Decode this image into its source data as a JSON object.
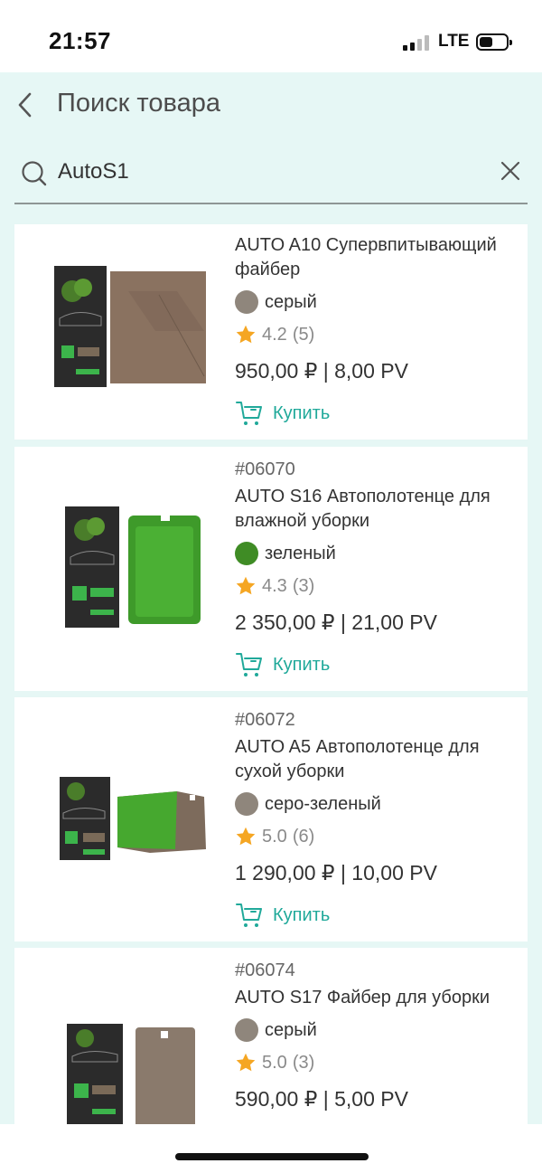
{
  "status_bar": {
    "time": "21:57",
    "network": "LTE",
    "battery_level": 0.4
  },
  "header": {
    "title": "Поиск товара"
  },
  "search": {
    "value": "AutoS1",
    "placeholder": ""
  },
  "colors": {
    "accent": "#20a99a",
    "star": "#f5a623",
    "background": "#e6f7f5"
  },
  "products": [
    {
      "code": "",
      "name": "AUTO A10 Супервпитывающий файбер",
      "color_name": "серый",
      "color_hex": "#8f867c",
      "rating": "4.2",
      "reviews": "(5)",
      "price": "950,00 ₽ | 8,00 PV",
      "buy_label": "Купить"
    },
    {
      "code": "#06070",
      "name": "AUTO S16 Автополотенце для влажной уборки",
      "color_name": "зеленый",
      "color_hex": "#3f8c25",
      "rating": "4.3",
      "reviews": "(3)",
      "price": "2 350,00 ₽ | 21,00 PV",
      "buy_label": "Купить"
    },
    {
      "code": "#06072",
      "name": "AUTO A5 Автополотенце для сухой уборки",
      "color_name": "серо-зеленый",
      "color_hex": "#8f867c",
      "rating": "5.0",
      "reviews": "(6)",
      "price": "1 290,00 ₽ | 10,00 PV",
      "buy_label": "Купить"
    },
    {
      "code": "#06074",
      "name": "AUTO S17 Файбер для уборки",
      "color_name": "серый",
      "color_hex": "#8f867c",
      "rating": "5.0",
      "reviews": "(3)",
      "price": "590,00 ₽ | 5,00 PV",
      "buy_label": ""
    }
  ]
}
